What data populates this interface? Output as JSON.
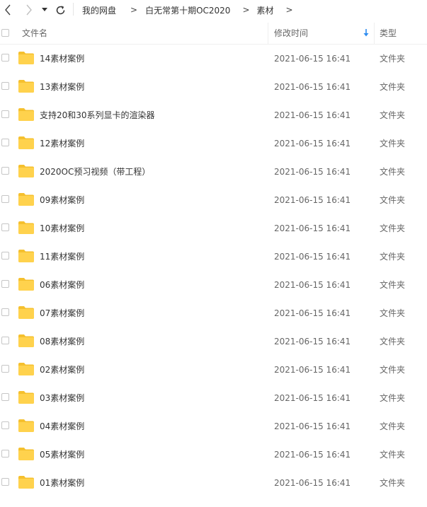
{
  "breadcrumb": {
    "items": [
      "我的网盘",
      "白无常第十期OC2020",
      "素材"
    ],
    "separator": ">"
  },
  "columns": {
    "name": "文件名",
    "modified": "修改时间",
    "type": "类型"
  },
  "sort": {
    "column": "modified",
    "direction": "descending"
  },
  "files": [
    {
      "name": "14素材案例",
      "modified": "2021-06-15 16:41",
      "type": "文件夹"
    },
    {
      "name": "13素材案例",
      "modified": "2021-06-15 16:41",
      "type": "文件夹"
    },
    {
      "name": "支持20和30系列显卡的渲染器",
      "modified": "2021-06-15 16:41",
      "type": "文件夹"
    },
    {
      "name": "12素材案例",
      "modified": "2021-06-15 16:41",
      "type": "文件夹"
    },
    {
      "name": "2020OC预习视频（带工程）",
      "modified": "2021-06-15 16:41",
      "type": "文件夹"
    },
    {
      "name": "09素材案例",
      "modified": "2021-06-15 16:41",
      "type": "文件夹"
    },
    {
      "name": "10素材案例",
      "modified": "2021-06-15 16:41",
      "type": "文件夹"
    },
    {
      "name": "11素材案例",
      "modified": "2021-06-15 16:41",
      "type": "文件夹"
    },
    {
      "name": "06素材案例",
      "modified": "2021-06-15 16:41",
      "type": "文件夹"
    },
    {
      "name": "07素材案例",
      "modified": "2021-06-15 16:41",
      "type": "文件夹"
    },
    {
      "name": "08素材案例",
      "modified": "2021-06-15 16:41",
      "type": "文件夹"
    },
    {
      "name": "02素材案例",
      "modified": "2021-06-15 16:41",
      "type": "文件夹"
    },
    {
      "name": "03素材案例",
      "modified": "2021-06-15 16:41",
      "type": "文件夹"
    },
    {
      "name": "04素材案例",
      "modified": "2021-06-15 16:41",
      "type": "文件夹"
    },
    {
      "name": "05素材案例",
      "modified": "2021-06-15 16:41",
      "type": "文件夹"
    },
    {
      "name": "01素材案例",
      "modified": "2021-06-15 16:41",
      "type": "文件夹"
    }
  ],
  "colors": {
    "folder": "#ffd24d",
    "folder_tab": "#f5c02e",
    "sort_arrow": "#2d8cf0"
  },
  "icons": [
    "back-arrow-icon",
    "forward-arrow-icon",
    "dropdown-caret-icon",
    "refresh-icon",
    "folder-icon",
    "sort-down-arrow-icon"
  ]
}
